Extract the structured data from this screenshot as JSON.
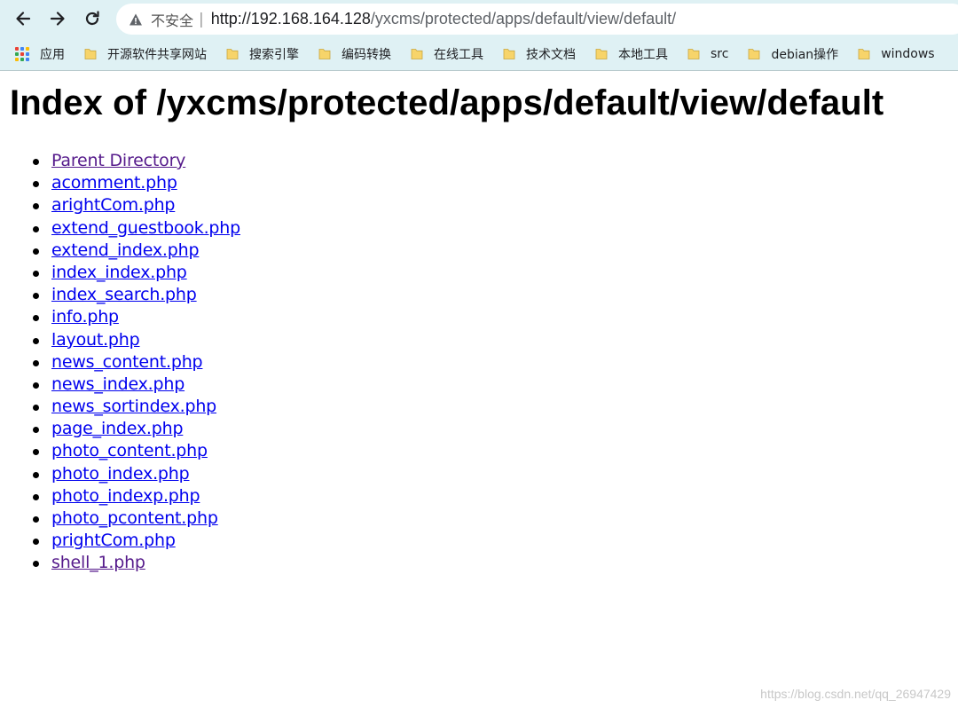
{
  "browser": {
    "address_bar": {
      "security_label": "不安全",
      "separator": "|",
      "url_host": "http://192.168.164.128",
      "url_path": "/yxcms/protected/apps/default/view/default/"
    },
    "nav_icons": {
      "back": "arrow-left-icon",
      "forward": "arrow-right-icon",
      "reload": "reload-icon",
      "warning": "warning-triangle-icon"
    }
  },
  "bookmarks": {
    "apps_label": "应用",
    "folders": [
      {
        "label": "开源软件共享网站"
      },
      {
        "label": "搜索引擎"
      },
      {
        "label": "编码转换"
      },
      {
        "label": "在线工具"
      },
      {
        "label": "技术文档"
      },
      {
        "label": "本地工具"
      },
      {
        "label": "src"
      },
      {
        "label": "debian操作"
      },
      {
        "label": "windows"
      }
    ],
    "folder_color": "#f7d46a"
  },
  "page": {
    "title": "Index of /yxcms/protected/apps/default/view/default",
    "files": [
      {
        "name": "Parent Directory",
        "visited": true
      },
      {
        "name": "acomment.php",
        "visited": false
      },
      {
        "name": "arightCom.php",
        "visited": false
      },
      {
        "name": "extend_guestbook.php",
        "visited": false
      },
      {
        "name": "extend_index.php",
        "visited": false
      },
      {
        "name": "index_index.php",
        "visited": false
      },
      {
        "name": "index_search.php",
        "visited": false
      },
      {
        "name": "info.php",
        "visited": false
      },
      {
        "name": "layout.php",
        "visited": false
      },
      {
        "name": "news_content.php",
        "visited": false
      },
      {
        "name": "news_index.php",
        "visited": false
      },
      {
        "name": "news_sortindex.php",
        "visited": false
      },
      {
        "name": "page_index.php",
        "visited": false
      },
      {
        "name": "photo_content.php",
        "visited": false
      },
      {
        "name": "photo_index.php",
        "visited": false
      },
      {
        "name": "photo_indexp.php",
        "visited": false
      },
      {
        "name": "photo_pcontent.php",
        "visited": false
      },
      {
        "name": "prightCom.php",
        "visited": false
      },
      {
        "name": "shell_1.php",
        "visited": true
      }
    ],
    "link_color": "#0000ee",
    "visited_color": "#551a8b"
  },
  "watermark": "https://blog.csdn.net/qq_26947429"
}
